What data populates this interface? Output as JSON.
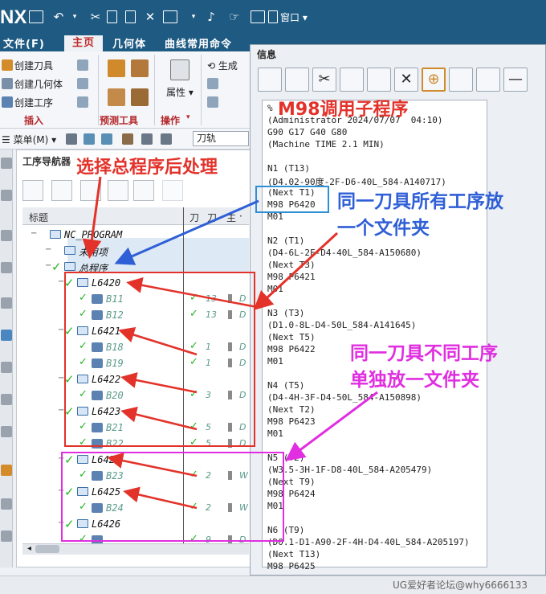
{
  "app": {
    "logo": "NX",
    "window_menu": "窗口"
  },
  "ribbon_tabs": [
    "文件(F)",
    "主页",
    "几何体",
    "曲线常用命令"
  ],
  "ribbon": {
    "create_tool": "创建刀具",
    "create_geometry": "创建几何体",
    "create_operation": "创建工序",
    "group_insert": "插入",
    "group_preview": "预测工具",
    "attributes": "属性",
    "group_operations": "操作",
    "generate": "生成"
  },
  "command_bar": {
    "menu": "菜单(M)",
    "filter": "刀轨"
  },
  "navigator": {
    "title": "工序导航器",
    "columns": [
      "标题",
      "刀",
      "刀",
      "主"
    ],
    "rows": [
      {
        "label": "NC_PROGRAM",
        "type": "root"
      },
      {
        "label": "未用项",
        "type": "folder"
      },
      {
        "label": "总程序",
        "type": "folder"
      },
      {
        "label": "L6420",
        "type": "program"
      },
      {
        "label": "B11",
        "type": "op",
        "num": "13",
        "last": "D"
      },
      {
        "label": "B12",
        "type": "op",
        "num": "13",
        "last": "D"
      },
      {
        "label": "L6421",
        "type": "program"
      },
      {
        "label": "B18",
        "type": "op",
        "num": "1",
        "last": "D"
      },
      {
        "label": "B19",
        "type": "op",
        "num": "1",
        "last": "D"
      },
      {
        "label": "L6422",
        "type": "program"
      },
      {
        "label": "B20",
        "type": "op",
        "num": "3",
        "last": "D"
      },
      {
        "label": "L6423",
        "type": "program"
      },
      {
        "label": "B21",
        "type": "op",
        "num": "5",
        "last": "D"
      },
      {
        "label": "B22",
        "type": "op",
        "num": "5",
        "last": "D"
      },
      {
        "label": "L6424",
        "type": "program"
      },
      {
        "label": "B23",
        "type": "op",
        "num": "2",
        "last": "W"
      },
      {
        "label": "L6425",
        "type": "program"
      },
      {
        "label": "B24",
        "type": "op",
        "num": "2",
        "last": "W"
      },
      {
        "label": "L6426",
        "type": "program"
      },
      {
        "label": "",
        "type": "op",
        "num": "9",
        "last": "D"
      }
    ]
  },
  "info_window": {
    "title": "信息",
    "lines": [
      "%",
      "(Administrator 2024/07/07  04:10)",
      "G90 G17 G40 G80",
      "(Machine TIME 2.1 MIN)",
      "",
      "N1 (T13)",
      "(D4.02-90度-2F-D6-40L_584-A140717)",
      "(Next T1)",
      "M98 P6420",
      "M01",
      "",
      "N2 (T1)",
      "(D4-6L-2F-D4-40L_584-A150680)",
      "(Next T3)",
      "M98 P6421",
      "M01",
      "",
      "N3 (T3)",
      "(D1.0-8L-D4-50L_584-A141645)",
      "(Next T5)",
      "M98 P6422",
      "M01",
      "",
      "N4 (T5)",
      "(D4-4H-3F-D4-50L_584-A150898)",
      "(Next T2)",
      "M98 P6423",
      "M01",
      "",
      "N5 (T2)",
      "(W3.5-3H-1F-D8-40L_584-A205479)",
      "(Next T9)",
      "M98 P6424",
      "M01",
      "",
      "N6 (T9)",
      "(D0.1-D1-A90-2F-4H-D4-40L_584-A205197)",
      "(Next T13)",
      "M98 P6425"
    ]
  },
  "annotations": {
    "select_post": "选择总程序后处理",
    "call_subprogram": "M98调用子程序",
    "same_tool_line1": "同一刀具所有工序放",
    "same_tool_line2": "一个文件夹",
    "diff_op_line1": "同一刀具不同工序",
    "diff_op_line2": "单独放一文件夹"
  },
  "watermark": "UG爱好者论坛@why6666133",
  "colors": {
    "titlebar": "#1e5a82",
    "annotation_red": "#e3322a",
    "annotation_blue": "#2f5fd6",
    "annotation_magenta": "#e02ee0",
    "check_green": "#25b525"
  }
}
